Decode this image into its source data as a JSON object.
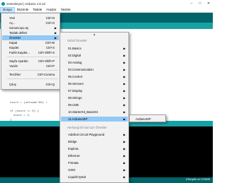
{
  "titlebar": {
    "title": "zemenleyici | Arduino 1.8.13",
    "minimize": "–",
    "maximize": "□",
    "close": "✕"
  },
  "menubar": {
    "items": [
      "Dosya",
      "Düzenle",
      "Taslak",
      "Araçlar",
      "Yardım"
    ]
  },
  "editor": {
    "lines": [
      "nsure = (setsaat*60) +",
      "",
      "if (nsure == 0) {",
      "  nsure = 1;",
      "}"
    ]
  },
  "statusbar": {
    "board": "ATtiny85 on COM35"
  },
  "file_menu": {
    "items": [
      {
        "label": "Yeni",
        "shortcut": "Ctrl+N"
      },
      {
        "label": "Aç...",
        "shortcut": "Ctrl+O"
      },
      {
        "label": "Sonuncuyu aç",
        "shortcut": ""
      },
      {
        "label": "Taslak defteri",
        "shortcut": ""
      },
      {
        "label": "Örnekler",
        "shortcut": ""
      },
      {
        "label": "Kapat",
        "shortcut": "Ctrl+W"
      },
      {
        "label": "Kaydet",
        "shortcut": "Ctrl+S"
      },
      {
        "label": "Farklı Kaydet...",
        "shortcut": "Ctrl+Shift+S"
      },
      {
        "label": "Sayfa Ayarları",
        "shortcut": "Ctrl+Shift+P"
      },
      {
        "label": "Yazdır",
        "shortcut": "Ctrl+P"
      },
      {
        "label": "Tercihler",
        "shortcut": "Ctrl+Comma"
      },
      {
        "label": "Çıkış",
        "shortcut": "Ctrl+Q"
      }
    ]
  },
  "examples_menu": {
    "scroll_up": "▲",
    "builtin_header": "Dahili Örnekler",
    "builtin": [
      "01.Basics",
      "02.Digital",
      "03.Analog",
      "04.Communication",
      "05.Control",
      "06.Sensors",
      "07.Display",
      "08.Strings",
      "09.USB",
      "10.StarterKit_BasicKit",
      "11.ArduinoISP"
    ],
    "any_board_header": "Herhangi bir kart için Örnekler",
    "any_board": [
      "Adafruit Circuit Playground",
      "Bridge",
      "Esplora",
      "Ethernet",
      "Firmata",
      "GSM",
      "LiquidCrystal"
    ],
    "arrow": "▶"
  },
  "isp_menu": {
    "items": [
      "ArduinoISP"
    ]
  },
  "colors": {
    "teal_dark": "#006468",
    "teal": "#17a1a5",
    "highlight": "#91c9f7"
  }
}
